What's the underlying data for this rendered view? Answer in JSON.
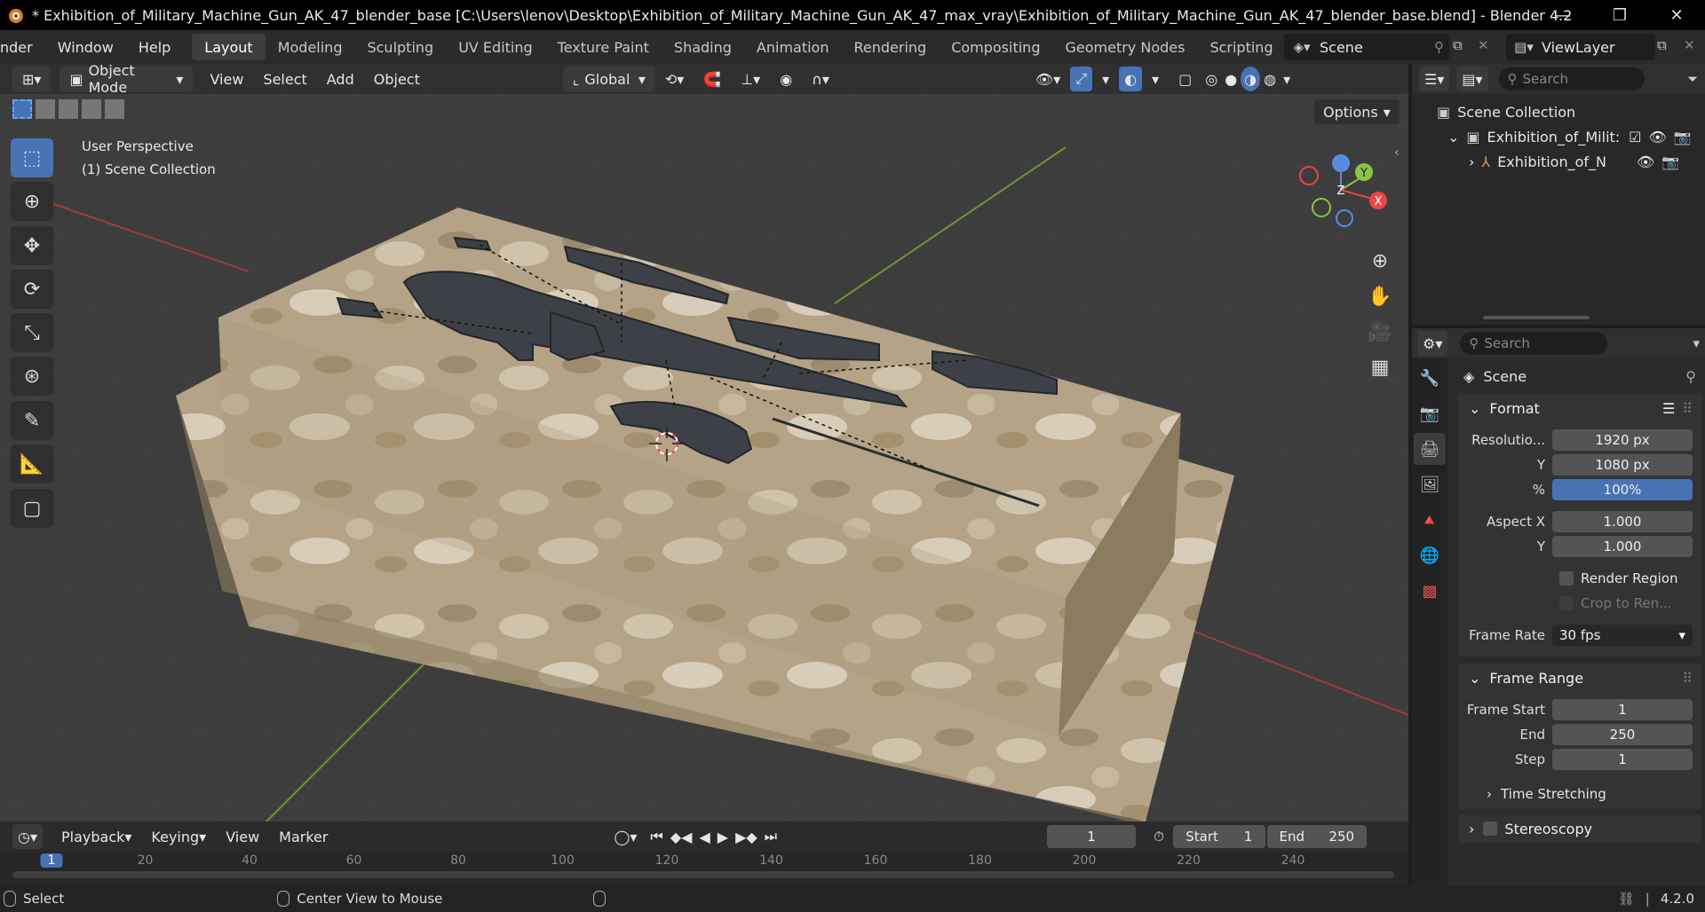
{
  "window": {
    "title": "* Exhibition_of_Military_Machine_Gun_AK_47_blender_base [C:\\Users\\lenov\\Desktop\\Exhibition_of_Military_Machine_Gun_AK_47_max_vray\\Exhibition_of_Military_Machine_Gun_AK_47_blender_base.blend] - Blender 4.2",
    "minimize": "—",
    "restore": "❐",
    "close": "✕"
  },
  "menus": [
    "nder",
    "Window",
    "Help"
  ],
  "workspaces": [
    "Layout",
    "Modeling",
    "Sculpting",
    "UV Editing",
    "Texture Paint",
    "Shading",
    "Animation",
    "Rendering",
    "Compositing",
    "Geometry Nodes",
    "Scripting"
  ],
  "scene_selector": {
    "label": "Scene"
  },
  "viewlayer_selector": {
    "label": "ViewLayer"
  },
  "viewport_header": {
    "mode": "Object Mode",
    "menus": [
      "View",
      "Select",
      "Add",
      "Object"
    ],
    "orientation": "Global",
    "options": "Options"
  },
  "viewport": {
    "perspective": "User Perspective",
    "collection": "(1) Scene Collection",
    "axes": {
      "x": "X",
      "y": "Y",
      "z": "Z"
    }
  },
  "outliner": {
    "search_placeholder": "Search",
    "items": [
      "Scene Collection",
      "Exhibition_of_Milit:",
      "Exhibition_of_N"
    ]
  },
  "properties": {
    "search_placeholder": "Search",
    "context": "Scene",
    "format": {
      "title": "Format",
      "resolution_label": "Resolutio...",
      "resolution_x": "1920 px",
      "y_label": "Y",
      "resolution_y": "1080 px",
      "pct_label": "%",
      "pct": "100%",
      "aspect_x_label": "Aspect X",
      "aspect_x": "1.000",
      "aspect_y_label": "Y",
      "aspect_y": "1.000",
      "render_region": "Render Region",
      "crop": "Crop to Ren...",
      "frame_rate_label": "Frame Rate",
      "frame_rate": "30 fps"
    },
    "frame_range": {
      "title": "Frame Range",
      "start_label": "Frame Start",
      "start": "1",
      "end_label": "End",
      "end": "250",
      "step_label": "Step",
      "step": "1"
    },
    "time_stretching": "Time Stretching",
    "stereoscopy": "Stereoscopy"
  },
  "timeline": {
    "menus": [
      "Playback",
      "Keying",
      "View",
      "Marker"
    ],
    "current_frame": "1",
    "start_label": "Start",
    "start": "1",
    "end_label": "End",
    "end": "250",
    "ruler": [
      "1",
      "20",
      "40",
      "60",
      "80",
      "100",
      "120",
      "140",
      "160",
      "180",
      "200",
      "220",
      "240"
    ]
  },
  "statusbar": {
    "select": "Select",
    "center": "Center View to Mouse",
    "version": "4.2.0"
  }
}
